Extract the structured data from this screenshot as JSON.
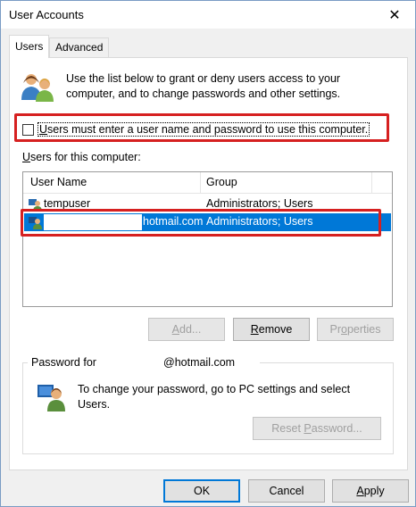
{
  "window": {
    "title": "User Accounts"
  },
  "tabs": [
    {
      "label": "Users",
      "active": true
    },
    {
      "label": "Advanced",
      "active": false
    }
  ],
  "intro_text": "Use the list below to grant or deny users access to your computer, and to change passwords and other settings.",
  "require_password": {
    "label_accel": "U",
    "label_rest": "sers must enter a user name and password to use this computer.",
    "checked": false
  },
  "users_section": {
    "label_accel": "U",
    "label_rest": "sers for this computer:"
  },
  "list": {
    "columns": [
      "User Name",
      "Group"
    ],
    "rows": [
      {
        "name": "tempuser",
        "group": "Administrators; Users",
        "selected": false
      },
      {
        "name": "hotmail.com",
        "group": "Administrators; Users",
        "selected": true
      }
    ]
  },
  "list_buttons": {
    "add": {
      "label_accel": "A",
      "label_rest": "dd...",
      "enabled": false
    },
    "remove": {
      "label_accel": "R",
      "label_rest": "emove",
      "enabled": true
    },
    "properties": {
      "label_before": "Pr",
      "label_accel": "o",
      "label_after": "perties",
      "enabled": false
    }
  },
  "password_group": {
    "legend_prefix": "Password for",
    "legend_suffix": "@hotmail.com",
    "text": "To change your password, go to PC settings and select Users.",
    "reset_button": {
      "label_before": "Reset ",
      "label_accel": "P",
      "label_after": "assword...",
      "enabled": false
    }
  },
  "dialog_buttons": {
    "ok": "OK",
    "cancel": "Cancel",
    "apply": {
      "label_accel": "A",
      "label_rest": "pply"
    }
  },
  "colors": {
    "highlight": "#0078d7",
    "annotation": "#d62020"
  }
}
